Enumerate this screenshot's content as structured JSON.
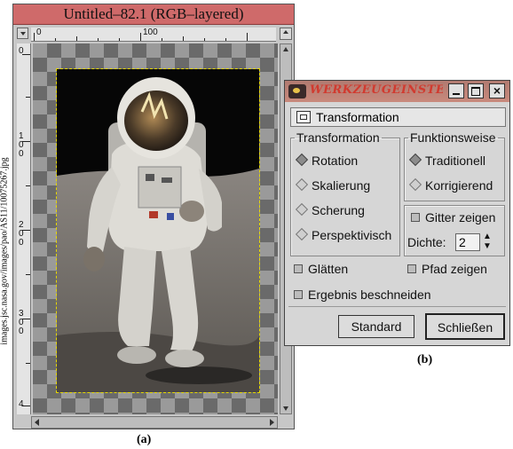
{
  "image_window": {
    "title": "Untitled–82.1 (RGB–layered)",
    "hruler_labels": [
      "0",
      "100"
    ],
    "vruler_labels": [
      "0",
      "1\n0\n0",
      "2\n0\n0",
      "3\n0\n0",
      "4"
    ],
    "side_text": "images.jsc.nasa.gov/images/pao/AS11/10075267.jpg"
  },
  "captions": {
    "a": "(a)",
    "b": "(b)"
  },
  "dialog": {
    "title": "WERKZEUGEINSTELLU...",
    "header_label": "Transformation",
    "transform_group": {
      "legend": "Transformation",
      "options": [
        {
          "label": "Rotation",
          "selected": true
        },
        {
          "label": "Skalierung",
          "selected": false
        },
        {
          "label": "Scherung",
          "selected": false
        },
        {
          "label": "Perspektivisch",
          "selected": false
        }
      ]
    },
    "mode_group": {
      "legend": "Funktionsweise",
      "options": [
        {
          "label": "Traditionell",
          "selected": true
        },
        {
          "label": "Korrigierend",
          "selected": false
        }
      ]
    },
    "grid_checkbox": "Gitter zeigen",
    "density_label": "Dichte:",
    "density_value": "2",
    "smooth_checkbox": "Glätten",
    "path_checkbox": "Pfad zeigen",
    "crop_checkbox": "Ergebnis beschneiden",
    "default_button": "Standard",
    "close_button": "Schließen"
  }
}
